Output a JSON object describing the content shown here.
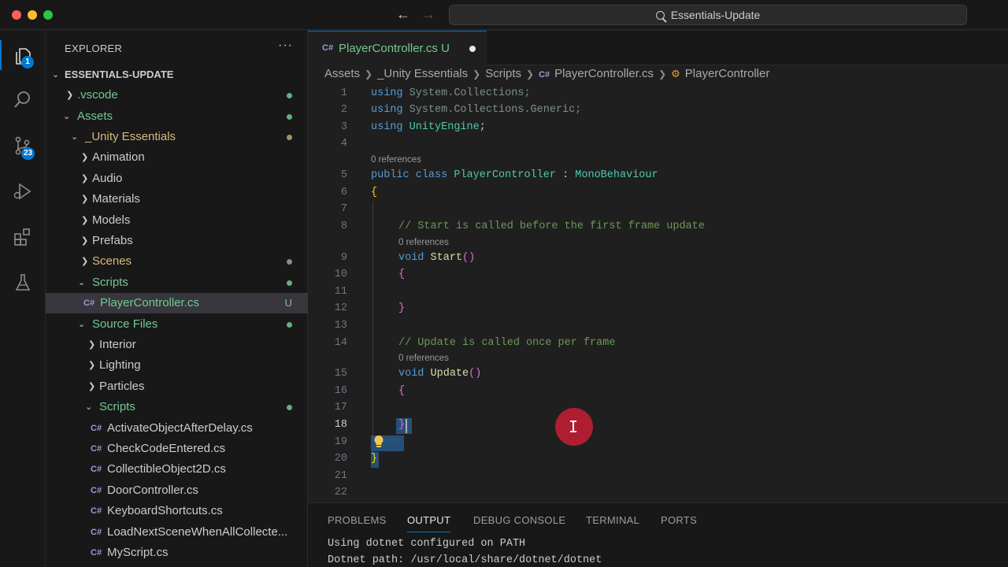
{
  "window": {
    "title": "Essentials-Update"
  },
  "activity": {
    "explorer_badge": "1",
    "scm_badge": "23"
  },
  "sidebar": {
    "header": "EXPLORER",
    "more": "···",
    "root": "ESSENTIALS-UPDATE",
    "items": [
      {
        "label": ".vscode",
        "status": "dot-green"
      },
      {
        "label": "Assets",
        "status": "dot-green"
      },
      {
        "label": "_Unity Essentials",
        "status": "dot-yellow"
      },
      {
        "label": "Animation"
      },
      {
        "label": "Audio"
      },
      {
        "label": "Materials"
      },
      {
        "label": "Models"
      },
      {
        "label": "Prefabs"
      },
      {
        "label": "Scenes",
        "status": "dot-gray"
      },
      {
        "label": "Scripts",
        "status": "dot-green"
      },
      {
        "label": "PlayerController.cs",
        "status": "U"
      },
      {
        "label": "Source Files",
        "status": "dot-green"
      },
      {
        "label": "Interior"
      },
      {
        "label": "Lighting"
      },
      {
        "label": "Particles"
      },
      {
        "label": "Scripts",
        "status": "dot-green"
      },
      {
        "label": "ActivateObjectAfterDelay.cs"
      },
      {
        "label": "CheckCodeEntered.cs"
      },
      {
        "label": "CollectibleObject2D.cs"
      },
      {
        "label": "DoorController.cs"
      },
      {
        "label": "KeyboardShortcuts.cs"
      },
      {
        "label": "LoadNextSceneWhenAllCollecte..."
      },
      {
        "label": "MyScript.cs"
      }
    ]
  },
  "editor": {
    "tab": {
      "label": "PlayerController.cs",
      "status": "U"
    },
    "breadcrumb": [
      "Assets",
      "_Unity Essentials",
      "Scripts",
      "PlayerController.cs",
      "PlayerController"
    ],
    "codelens": "0 references",
    "code": {
      "l1_kw": "using",
      "l1_ns": "System.Collections",
      "l1_end": ";",
      "l2_kw": "using",
      "l2_ns": "System.Collections.Generic",
      "l2_end": ";",
      "l3_kw": "using",
      "l3_ns": "UnityEngine",
      "l3_end": ";",
      "l5_public": "public",
      "l5_class": "class",
      "l5_name": "PlayerController",
      "l5_colon": " : ",
      "l5_base": "MonoBehaviour",
      "open_brace": "{",
      "close_brace": "}",
      "l8_comment": "// Start is called before the first frame update",
      "l9_void": "void",
      "l9_fn": "Start",
      "parens": "()",
      "l14_comment": "// Update is called once per frame",
      "l15_void": "void",
      "l15_fn": "Update",
      "dotted": "··"
    },
    "line_numbers": [
      "1",
      "2",
      "3",
      "4",
      "5",
      "6",
      "7",
      "8",
      "9",
      "10",
      "11",
      "12",
      "13",
      "14",
      "15",
      "16",
      "17",
      "18",
      "19",
      "20",
      "21",
      "22"
    ]
  },
  "panel": {
    "tabs": [
      "PROBLEMS",
      "OUTPUT",
      "DEBUG CONSOLE",
      "TERMINAL",
      "PORTS"
    ],
    "output": [
      "Using dotnet configured on PATH",
      "Dotnet path: /usr/local/share/dotnet/dotnet"
    ]
  }
}
